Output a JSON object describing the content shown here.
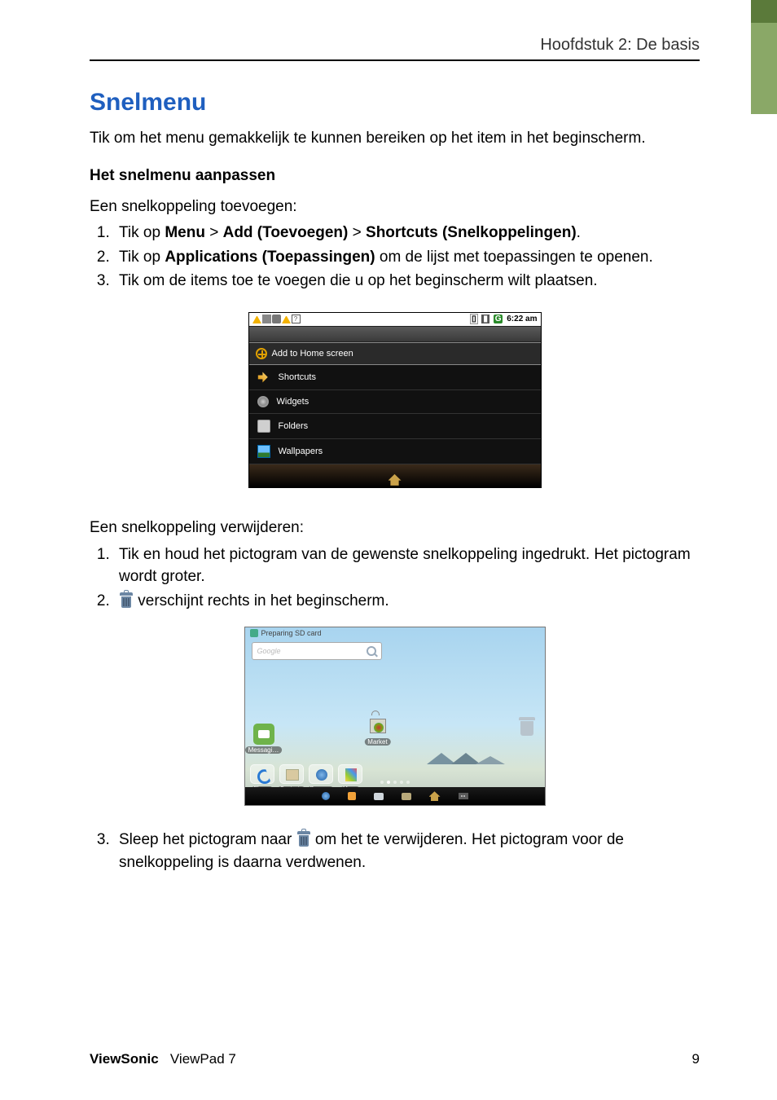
{
  "header": {
    "chapter": "Hoofdstuk 2: De basis"
  },
  "title": "Snelmenu",
  "intro": "Tik om het menu gemakkelijk te kunnen bereiken op het item in het beginscherm.",
  "sub1": "Het snelmenu aanpassen",
  "add_intro": "Een snelkoppeling toevoegen:",
  "add_steps": {
    "s1a": "Tik op ",
    "s1b": "Menu",
    "s1c": " > ",
    "s1d": "Add (Toevoegen)",
    "s1e": " > ",
    "s1f": "Shortcuts (Snelkoppelingen)",
    "s1g": ".",
    "s2a": "Tik op ",
    "s2b": "Applications (Toepassingen)",
    "s2c": " om de lijst met toepassingen te openen.",
    "s3": "Tik om de items toe te voegen die u op het beginscherm wilt plaatsen."
  },
  "fig1": {
    "time": "6:22 am",
    "panel_title": "Add to Home screen",
    "items": [
      "Shortcuts",
      "Widgets",
      "Folders",
      "Wallpapers"
    ]
  },
  "del_intro": "Een snelkoppeling verwijderen:",
  "del_steps": {
    "s1": "Tik en houd het pictogram van de gewenste snelkoppeling ingedrukt. Het pictogram wordt groter.",
    "s2": " verschijnt rechts in het beginscherm."
  },
  "fig2": {
    "status": "Preparing SD card",
    "search_placeholder": "Google",
    "apps": {
      "messaging": "Messagi…",
      "market": "Market"
    },
    "dock": [
      "Phone",
      "Contacts",
      "Browser",
      "Maps"
    ]
  },
  "step3": {
    "a": "Sleep het pictogram naar ",
    "b": " om het te verwijderen. Het pictogram voor de snelkoppeling is daarna verdwenen."
  },
  "footer": {
    "brand": "ViewSonic",
    "product": "ViewPad 7",
    "page": "9"
  }
}
